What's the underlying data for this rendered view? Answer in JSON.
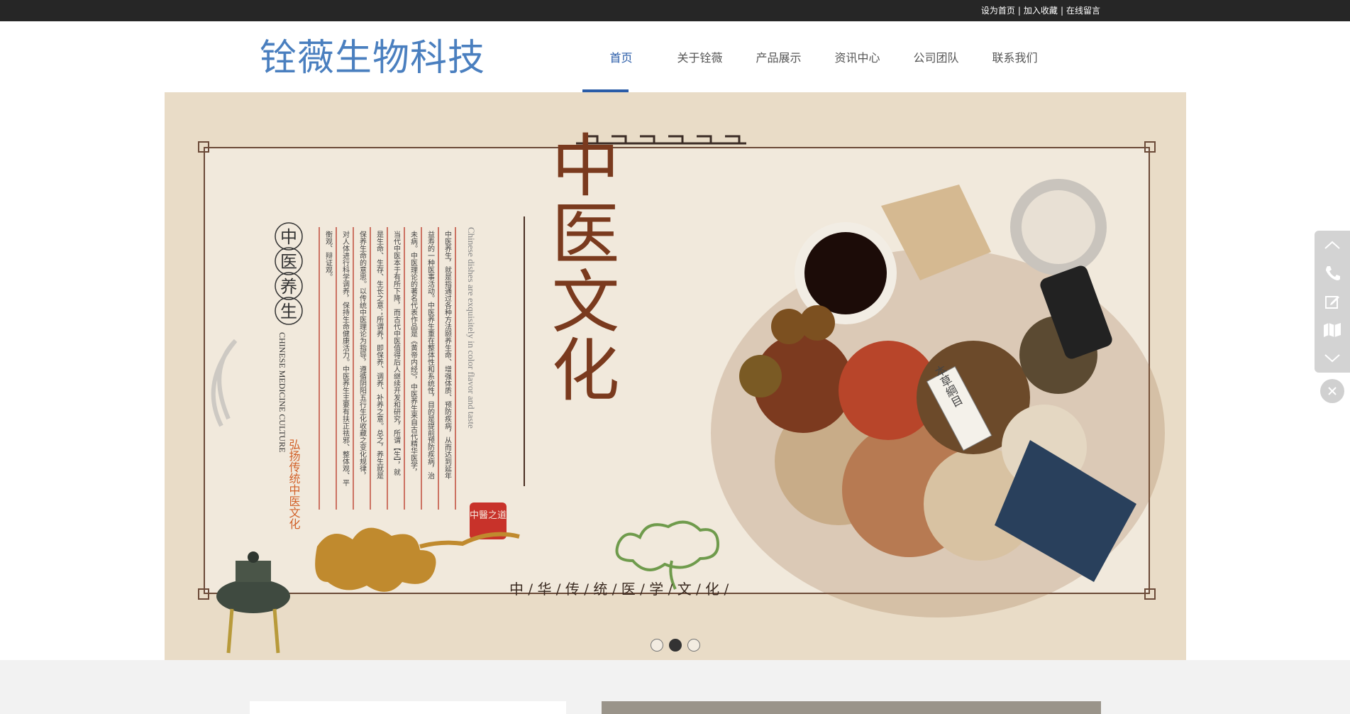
{
  "topbar": {
    "links": [
      "设为首页",
      "加入收藏",
      "在线留言"
    ],
    "separator": "|"
  },
  "header": {
    "logo": "铨薇生物科技",
    "nav": [
      "首页",
      "关于铨薇",
      "产品展示",
      "资讯中心",
      "公司团队",
      "联系我们"
    ],
    "active_index": 0
  },
  "banner": {
    "main_title": "中医文化",
    "circle_chars": [
      "中",
      "医",
      "养",
      "生"
    ],
    "english_vertical": "CHINESE MEDICINE CULTURE",
    "slogan": "弘扬传统中医文化",
    "english_quote": "Chinese dishes are exquisitely in color flavor and taste",
    "seal": "中醫之道",
    "book_title": "本草綱目",
    "bottom_line": "中 / 华 / 传 / 统 /   医 / 学 / 文 / 化 /",
    "paragraph_columns": [
      "中医养生，就是指通过各种方法颐养生命、增强体质、预防疾病，从而达到延年",
      "益寿的一种医事活动。中医养生重在整体性和系统性，目的是提前预防疾病，治",
      "未病。中医理论的著名代表作品是《黄帝内经》，中医养生来自古代精华医学，",
      "当代中医本于有所下降，而古代中医值得后人继续开发和研究，所谓【生】，就",
      "是生命、生存、生长之意；所谓养，即保养、调养、补养之意。总之，养生就是",
      "保养生命的意思。以传统中医理论为指导，遵循阴阳五行生化收藏之变化规律，",
      "对人体进行科学调养，保持生命健康活力。中医养生主要有扶正祛邪、整体观、平",
      "衡观、辩证观。"
    ],
    "slides": 3,
    "active_slide": 1
  },
  "side_tools": [
    "chevron-up-icon",
    "phone-icon",
    "edit-icon",
    "map-icon",
    "chevron-down-icon"
  ],
  "colors": {
    "nav_active": "#2a5ca8",
    "logo": "#4a7fbf",
    "topbar_bg": "#262626",
    "title_brown": "#7a3a1e",
    "seal_red": "#c8322a"
  }
}
